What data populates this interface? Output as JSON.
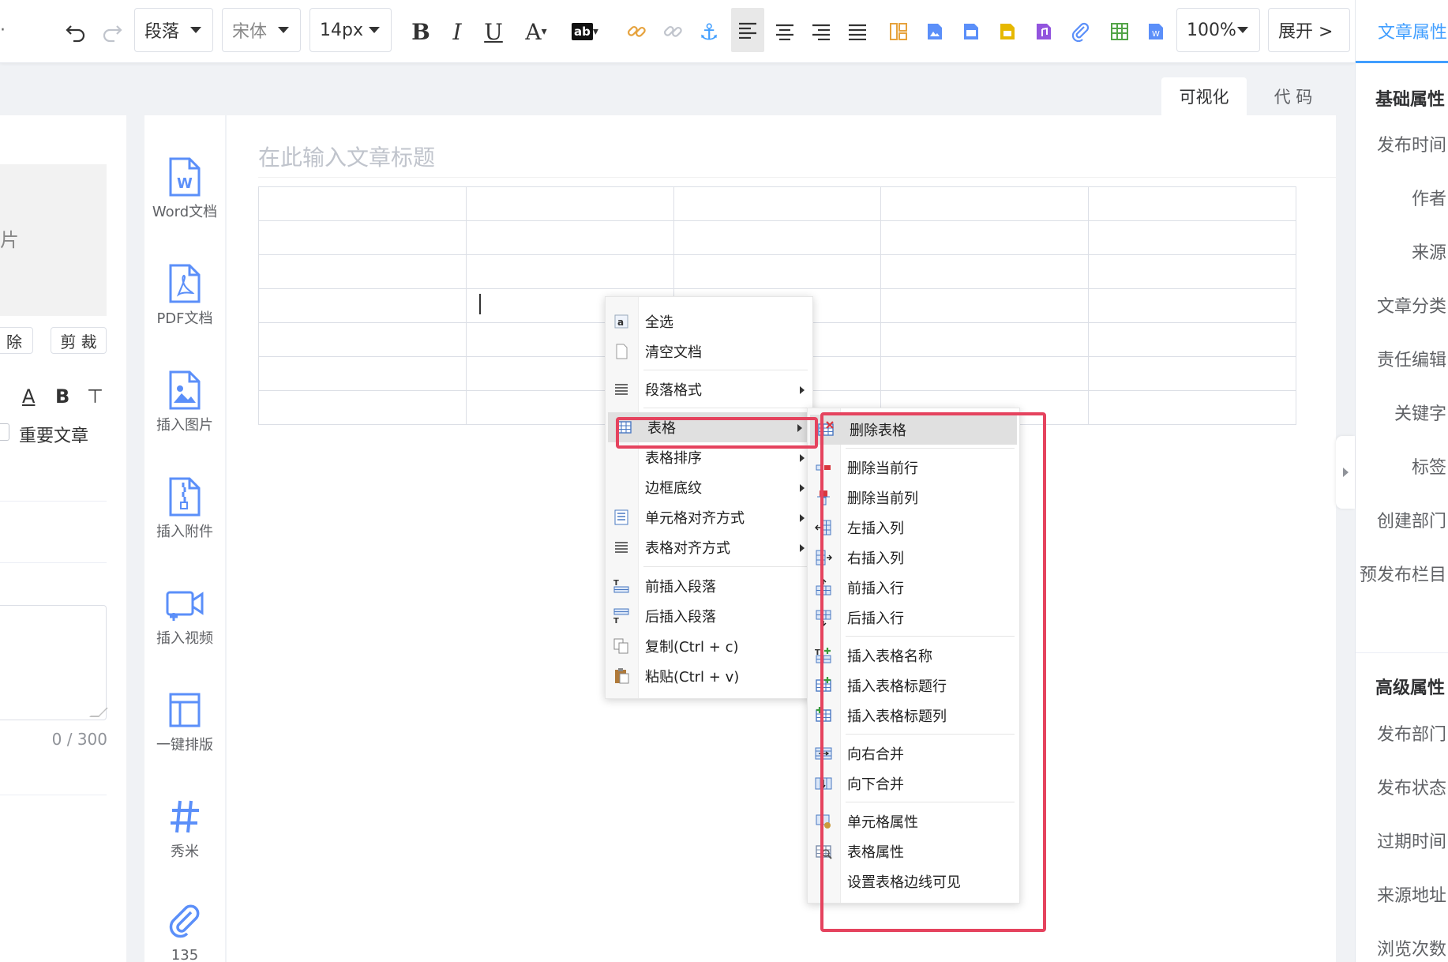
{
  "toolbar": {
    "paragraph": "段落",
    "font": "宋体",
    "size": "14px",
    "zoom": "100%",
    "expand": "展开 >"
  },
  "tabs": {
    "visual": "可视化",
    "code": "代 码"
  },
  "editor": {
    "title_placeholder": "在此输入文章标题"
  },
  "left": {
    "img_label": "片",
    "btn_delete": "除",
    "btn_crop": "剪 裁",
    "important": "重要文章",
    "count": "0 / 300"
  },
  "insert": [
    {
      "label": "Word文档",
      "icon": "word-doc-icon"
    },
    {
      "label": "PDF文档",
      "icon": "pdf-doc-icon"
    },
    {
      "label": "插入图片",
      "icon": "image-icon"
    },
    {
      "label": "插入附件",
      "icon": "zip-file-icon"
    },
    {
      "label": "插入视频",
      "icon": "video-icon"
    },
    {
      "label": "一键排版",
      "icon": "layout-icon"
    },
    {
      "label": "秀米",
      "icon": "hash-icon"
    },
    {
      "label": "135",
      "icon": "paperclip-icon"
    }
  ],
  "sidebar": {
    "tab": "文章属性",
    "basic": "基础属性",
    "basic_fields": [
      "发布时间",
      "作者",
      "来源",
      "文章分类",
      "责任编辑",
      "关键字",
      "标签",
      "创建部门",
      "预发布栏目"
    ],
    "advanced": "高级属性",
    "advanced_fields": [
      "发布部门",
      "发布状态",
      "过期时间",
      "来源地址",
      "浏览次数"
    ]
  },
  "menu": [
    {
      "label": "全选",
      "icon": "select-all-icon"
    },
    {
      "label": "清空文档",
      "icon": "clear-document-icon"
    },
    {
      "label": "段落格式",
      "icon": "paragraph-icon",
      "sub": true
    },
    {
      "label": "表格",
      "icon": "table-icon",
      "sub": true,
      "highlight": true
    },
    {
      "label": "表格排序",
      "sub": true
    },
    {
      "label": "边框底纹",
      "sub": true
    },
    {
      "label": "单元格对齐方式",
      "icon": "cell-align-icon",
      "sub": true
    },
    {
      "label": "表格对齐方式",
      "icon": "table-align-icon",
      "sub": true
    },
    {
      "label": "前插入段落",
      "icon": "insert-para-before-icon"
    },
    {
      "label": "后插入段落",
      "icon": "insert-para-after-icon"
    },
    {
      "label": "复制(Ctrl + c)",
      "icon": "copy-icon"
    },
    {
      "label": "粘贴(Ctrl + v)",
      "icon": "paste-icon"
    }
  ],
  "submenu": [
    {
      "label": "删除表格",
      "icon": "delete-table-icon",
      "highlight": true
    },
    {
      "label": "删除当前行",
      "icon": "delete-row-icon"
    },
    {
      "label": "删除当前列",
      "icon": "delete-col-icon"
    },
    {
      "label": "左插入列",
      "icon": "insert-col-left-icon"
    },
    {
      "label": "右插入列",
      "icon": "insert-col-right-icon"
    },
    {
      "label": "前插入行",
      "icon": "insert-row-before-icon"
    },
    {
      "label": "后插入行",
      "icon": "insert-row-after-icon"
    },
    {
      "label": "插入表格名称",
      "icon": "insert-caption-icon"
    },
    {
      "label": "插入表格标题行",
      "icon": "insert-title-row-icon"
    },
    {
      "label": "插入表格标题列",
      "icon": "insert-title-col-icon"
    },
    {
      "label": "向右合并",
      "icon": "merge-right-icon"
    },
    {
      "label": "向下合并",
      "icon": "merge-down-icon"
    },
    {
      "label": "单元格属性",
      "icon": "cell-props-icon"
    },
    {
      "label": "表格属性",
      "icon": "table-props-icon"
    },
    {
      "label": "设置表格边线可见"
    }
  ],
  "colors": {
    "accent": "#409eff",
    "highlight_box": "#e5435e"
  }
}
